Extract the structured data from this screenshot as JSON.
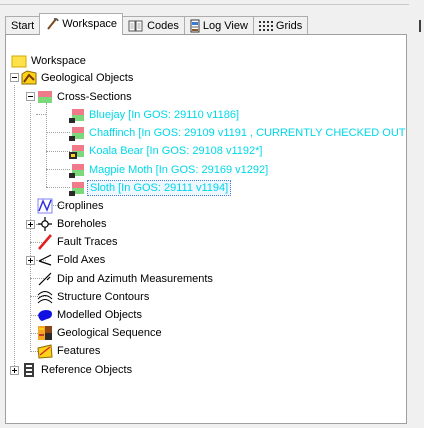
{
  "tabs": [
    {
      "label": "Start",
      "icon": "none",
      "active": false
    },
    {
      "label": "Workspace",
      "icon": "workspace-pick-icon",
      "active": true
    },
    {
      "label": "Codes",
      "icon": "book-icon",
      "active": false
    },
    {
      "label": "Log View",
      "icon": "log-icon",
      "active": false
    },
    {
      "label": "Grids",
      "icon": "grid-icon",
      "active": false
    }
  ],
  "tree": {
    "root": {
      "label": "Workspace",
      "icon": "folder-icon"
    },
    "geological_objects": {
      "label": "Geological Objects",
      "icon": "geology-folder-icon",
      "expanded": true,
      "cross_sections": {
        "label": "Cross-Sections",
        "icon": "cross-section-icon",
        "expanded": true,
        "items": [
          {
            "label": "Bluejay  [In GOS: 29110 v1186]",
            "icon": "section-layer-icon"
          },
          {
            "label": "Chaffinch  [In GOS: 29109 v1191 , CURRENTLY CHECKED OUT",
            "icon": "section-layer-icon"
          },
          {
            "label": "Koala Bear  [In GOS: 29108 v1192*]",
            "icon": "section-layer-modified-icon"
          },
          {
            "label": "Magpie Moth  [In GOS: 29169 v1292]",
            "icon": "section-layer-icon"
          },
          {
            "label": "Sloth  [In GOS: 29111 v1194]",
            "icon": "section-layer-icon",
            "selected": true
          }
        ]
      },
      "children": [
        {
          "label": "Croplines",
          "icon": "cropline-icon",
          "expander": "plus"
        },
        {
          "label": "Boreholes",
          "icon": "borehole-icon",
          "expander": "none"
        },
        {
          "label": "Fault Traces",
          "icon": "fault-trace-icon",
          "expander": "plus"
        },
        {
          "label": "Fold Axes",
          "icon": "fold-axis-icon",
          "expander": "none"
        },
        {
          "label": "Dip and Azimuth Measurements",
          "icon": "dip-azimuth-icon",
          "expander": "none"
        },
        {
          "label": "Structure Contours",
          "icon": "contour-icon",
          "expander": "none"
        },
        {
          "label": "Modelled Objects",
          "icon": "modelled-object-icon",
          "expander": "none"
        },
        {
          "label": "Geological Sequence",
          "icon": "sequence-icon",
          "expander": "none"
        },
        {
          "label": "Features",
          "icon": "features-icon",
          "expander": "none"
        }
      ]
    },
    "reference_objects": {
      "label": "Reference Objects",
      "icon": "reference-icon",
      "expanded": false
    }
  },
  "colors": {
    "checked_in_text": "#00d8e8",
    "fault_red": "#e02020",
    "blue_object": "#1010e0",
    "folder_yellow": "#ffe24a"
  }
}
